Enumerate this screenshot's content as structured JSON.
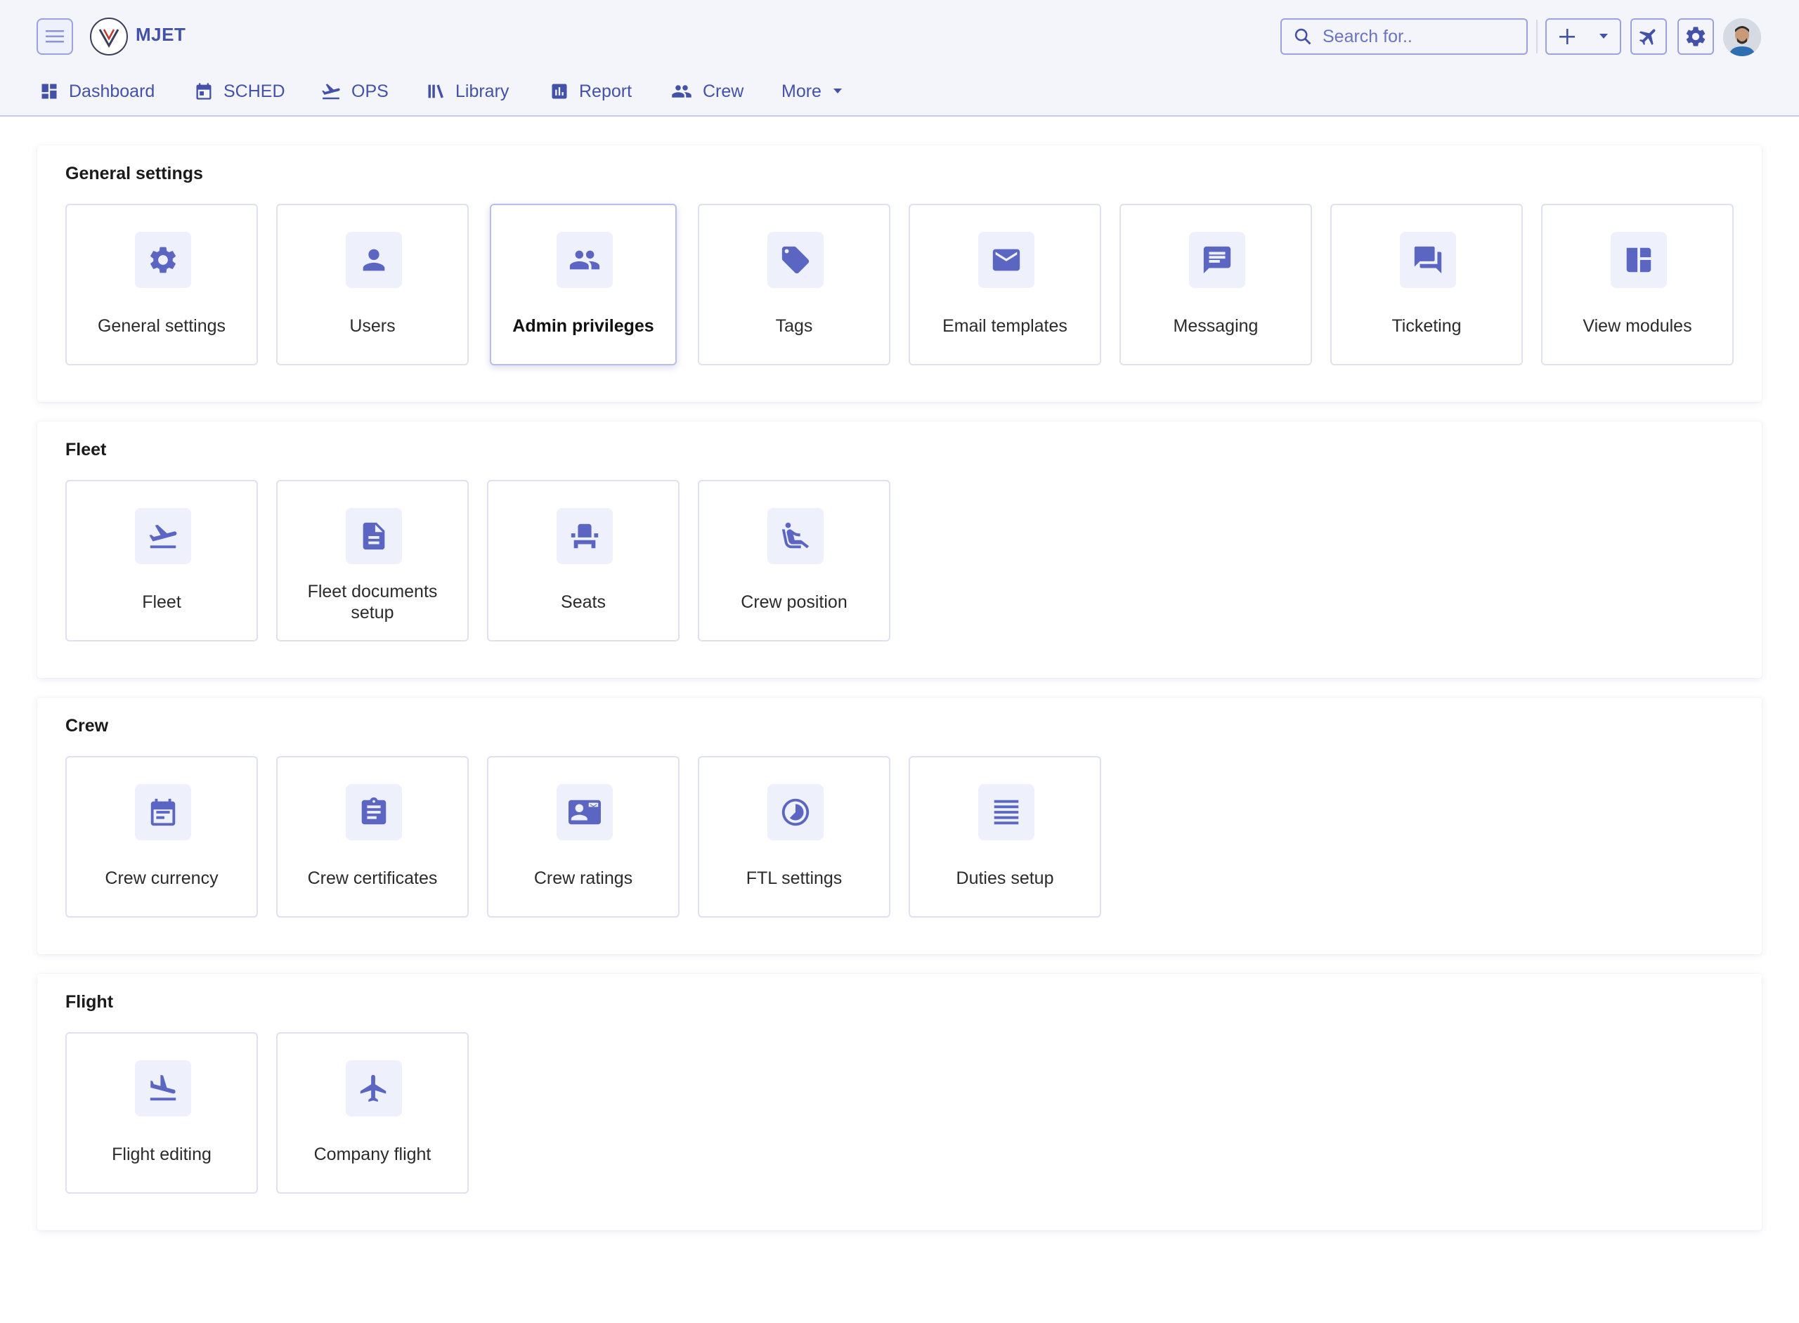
{
  "app": {
    "title": "MJET"
  },
  "search": {
    "placeholder": "Search for.."
  },
  "nav": [
    {
      "label": "Dashboard",
      "icon": "dashboard-icon"
    },
    {
      "label": "SCHED",
      "icon": "calendar-icon"
    },
    {
      "label": "OPS",
      "icon": "departure-icon"
    },
    {
      "label": "Library",
      "icon": "library-icon"
    },
    {
      "label": "Report",
      "icon": "report-icon"
    },
    {
      "label": "Crew",
      "icon": "people-icon"
    },
    {
      "label": "More",
      "icon": "caret-down-icon"
    }
  ],
  "sections": [
    {
      "title": "General settings",
      "cards": [
        {
          "label": "General settings",
          "icon": "gear-icon"
        },
        {
          "label": "Users",
          "icon": "user-icon"
        },
        {
          "label": "Admin privileges",
          "icon": "group-icon",
          "active": true
        },
        {
          "label": "Tags",
          "icon": "tag-icon"
        },
        {
          "label": "Email templates",
          "icon": "mail-icon"
        },
        {
          "label": "Messaging",
          "icon": "message-icon"
        },
        {
          "label": "Ticketing",
          "icon": "forum-icon"
        },
        {
          "label": "View modules",
          "icon": "modules-icon"
        }
      ]
    },
    {
      "title": "Fleet",
      "cards": [
        {
          "label": "Fleet",
          "icon": "takeoff-icon"
        },
        {
          "label": "Fleet documents setup",
          "icon": "document-icon"
        },
        {
          "label": "Seats",
          "icon": "seat-icon"
        },
        {
          "label": "Crew position",
          "icon": "seated-person-icon"
        }
      ]
    },
    {
      "title": "Crew",
      "cards": [
        {
          "label": "Crew currency",
          "icon": "event-calendar-icon"
        },
        {
          "label": "Crew certificates",
          "icon": "clipboard-icon"
        },
        {
          "label": "Crew ratings",
          "icon": "contact-card-icon"
        },
        {
          "label": "FTL settings",
          "icon": "clock-pie-icon"
        },
        {
          "label": "Duties setup",
          "icon": "lines-icon"
        }
      ]
    },
    {
      "title": "Flight",
      "cards": [
        {
          "label": "Flight editing",
          "icon": "landing-icon"
        },
        {
          "label": "Company flight",
          "icon": "airplane-icon"
        }
      ]
    }
  ]
}
